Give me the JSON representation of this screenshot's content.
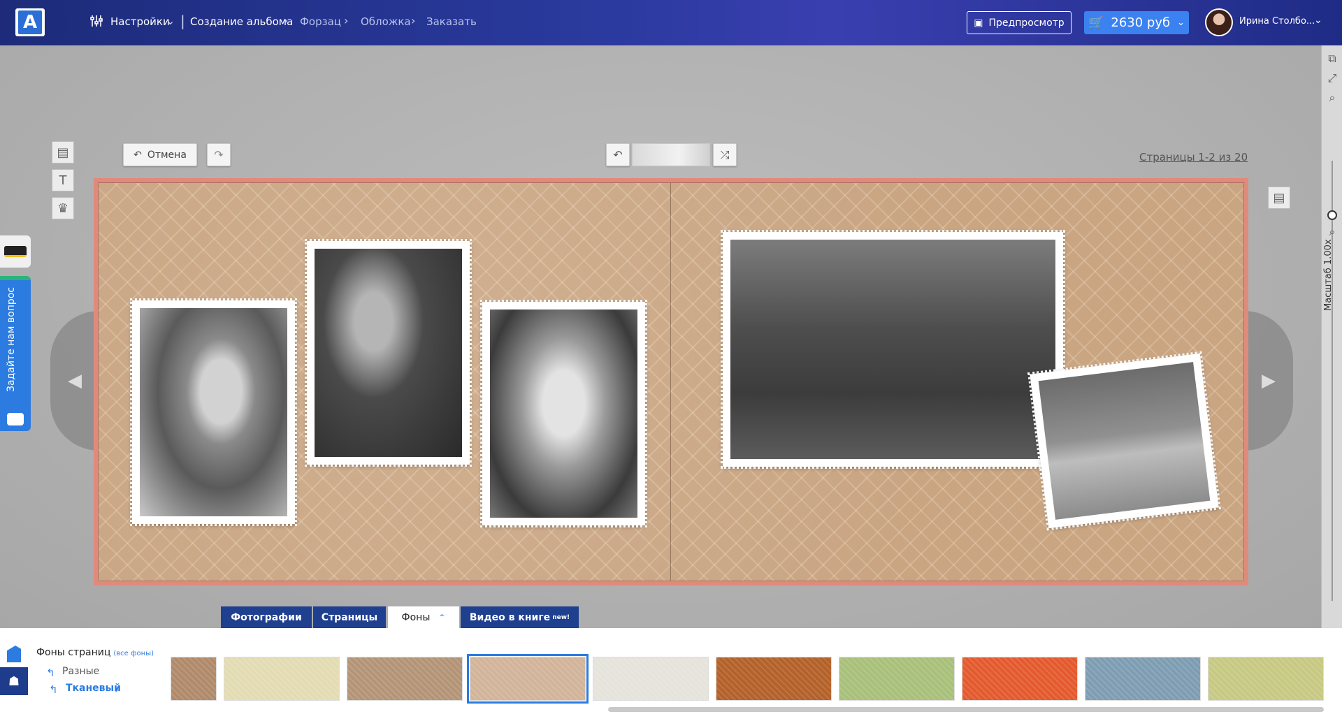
{
  "header": {
    "logo": "A",
    "settings": "Настройки",
    "breadcrumbs": [
      "Создание альбома",
      "Форзац",
      "Обложка",
      "Заказать"
    ],
    "preview": "Предпросмотр",
    "cart_price": "2630 руб",
    "user_name": "Ирина Столбо..."
  },
  "toolbar": {
    "cancel": "Отмена",
    "pages_label": "Страницы 1-2 из 20"
  },
  "zoom": {
    "label": "Масштаб  1.00x"
  },
  "support": {
    "ask": "Задайте нам вопрос"
  },
  "tabs": [
    {
      "label": "Фотографии"
    },
    {
      "label": "Страницы"
    },
    {
      "label": "Фоны"
    },
    {
      "label": "Видео в книге",
      "badge": "new!"
    }
  ],
  "backgrounds_panel": {
    "title": "Фоны страниц",
    "all_link": "(все фоны)",
    "categories": [
      "Разные",
      "Тканевый"
    ],
    "swatch_colors": [
      "#b08a6a",
      "#e3dcb3",
      "#b49477",
      "#d2b49a",
      "#e6e3dc",
      "#b4612a",
      "#a8c07a",
      "#e45a2e",
      "#7f9db2",
      "#c7c983"
    ],
    "selected_index": 3
  },
  "colors": {
    "accent": "#2c7be0",
    "header": "#1d2b7a",
    "spread_border": "#e08a7c",
    "spread_fill": "#c9a582"
  }
}
